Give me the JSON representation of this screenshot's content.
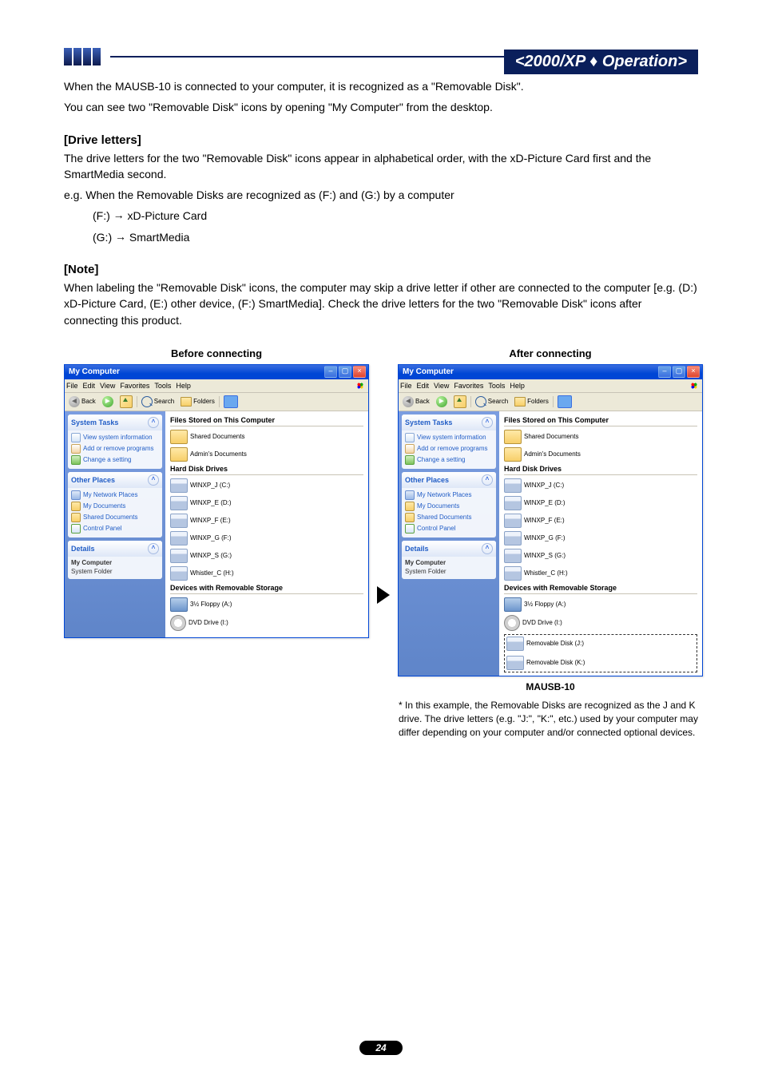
{
  "header": {
    "title": "<2000/XP ♦ Operation>"
  },
  "intro": {
    "p1": "When the MAUSB-10 is connected to your computer, it is recognized as a \"Removable Disk\".",
    "p2": "You can see two \"Removable Disk\" icons by opening \"My Computer\" from the desktop."
  },
  "drive_letters": {
    "heading": "[Drive letters]",
    "p1": "The drive letters for the two \"Removable Disk\" icons appear in alphabetical order, with the xD-Picture Card first and the SmartMedia second.",
    "p2": "e.g. When the Removable Disks are recognized as (F:) and (G:) by a computer",
    "line1_a": "(F:)",
    "line1_b": "xD-Picture Card",
    "line2_a": "(G:)",
    "line2_b": "SmartMedia"
  },
  "note": {
    "heading": "[Note]",
    "p": "When labeling the \"Removable Disk\" icons, the computer may skip a drive letter if other are connected to the computer [e.g. (D:) xD-Picture Card, (E:) other device, (F:) SmartMedia]. Check the drive letters for the two \"Removable Disk\" icons after connecting this product."
  },
  "compare": {
    "before_caption": "Before connecting",
    "after_caption": "After connecting",
    "below_after": "MAUSB-10",
    "footnote": "* In this example, the Removable Disks are recognized as the J and K drive. The drive letters (e.g. \"J:\", \"K:\", etc.) used by your computer may differ depending on your computer and/or connected optional devices."
  },
  "xp": {
    "title": "My Computer",
    "menus": [
      "File",
      "Edit",
      "View",
      "Favorites",
      "Tools",
      "Help"
    ],
    "toolbar": {
      "back": "Back",
      "search": "Search",
      "folders": "Folders"
    },
    "side": {
      "system_tasks": {
        "title": "System Tasks",
        "links": [
          "View system information",
          "Add or remove programs",
          "Change a setting"
        ]
      },
      "other_places": {
        "title": "Other Places",
        "links": [
          "My Network Places",
          "My Documents",
          "Shared Documents",
          "Control Panel"
        ]
      },
      "details": {
        "title": "Details",
        "line1": "My Computer",
        "line2": "System Folder"
      }
    },
    "content": {
      "cat1": "Files Stored on This Computer",
      "files": [
        "Shared Documents",
        "Admin's Documents"
      ],
      "cat2": "Hard Disk Drives",
      "hdd_before": [
        "WINXP_J (C:)",
        "WINXP_E (D:)",
        "WINXP_F (E:)",
        "WINXP_G (F:)",
        "WINXP_S (G:)",
        "Whistler_C (H:)"
      ],
      "hdd_after": [
        "WINXP_J (C:)",
        "WINXP_E (D:)",
        "WINXP_F (E:)",
        "WINXP_G (F:)",
        "WINXP_S (G:)",
        "Whistler_C (H:)"
      ],
      "cat3": "Devices with Removable Storage",
      "removable_before": [
        "3½ Floppy (A:)",
        "DVD Drive (I:)"
      ],
      "removable_after_top": [
        "3½ Floppy (A:)",
        "DVD Drive (I:)"
      ],
      "removable_after_new": [
        "Removable Disk (J:)",
        "Removable Disk (K:)"
      ]
    }
  },
  "page_number": "24"
}
